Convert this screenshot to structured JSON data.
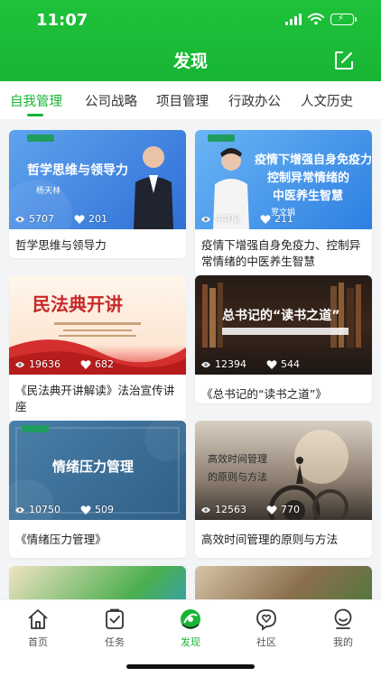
{
  "status": {
    "time": "11:07"
  },
  "header": {
    "title": "发现"
  },
  "tabs": [
    {
      "label": "自我管理"
    },
    {
      "label": "公司战略"
    },
    {
      "label": "项目管理"
    },
    {
      "label": "行政办公"
    },
    {
      "label": "人文历史"
    }
  ],
  "cards": [
    {
      "title": "哲学思维与领导力",
      "views": "5707",
      "likes": "201",
      "thumb_title": "哲学思维与领导力",
      "thumb_sub": "杨天林"
    },
    {
      "title": "疫情下增强自身免疫力、控制异常情绪的中医养生智慧",
      "views": "4402",
      "likes": "211",
      "thumb_line1": "疫情下增强自身免疫力",
      "thumb_line2": "控制异常情绪的",
      "thumb_line3": "中医养生智慧",
      "thumb_sub": "罗文娟"
    },
    {
      "title": "《民法典开讲解读》法治宣传讲座",
      "views": "19636",
      "likes": "682",
      "thumb_title": "民法典开讲"
    },
    {
      "title": "《总书记的“读书之道”》",
      "views": "12394",
      "likes": "544",
      "thumb_title": "总书记的“读书之道”"
    },
    {
      "title": "《情绪压力管理》",
      "views": "10750",
      "likes": "509",
      "thumb_title": "情绪压力管理"
    },
    {
      "title": "高效时间管理的原则与方法",
      "views": "12563",
      "likes": "770",
      "thumb_line1": "高效时间管理",
      "thumb_line2": "的原则与方法"
    }
  ],
  "tabbar": [
    {
      "label": "首页",
      "icon": "home-icon"
    },
    {
      "label": "任务",
      "icon": "task-icon"
    },
    {
      "label": "发现",
      "icon": "discover-icon"
    },
    {
      "label": "社区",
      "icon": "community-icon"
    },
    {
      "label": "我的",
      "icon": "profile-icon"
    }
  ],
  "colors": {
    "brand_green": "#17b534",
    "background": "#f3f4f6"
  }
}
